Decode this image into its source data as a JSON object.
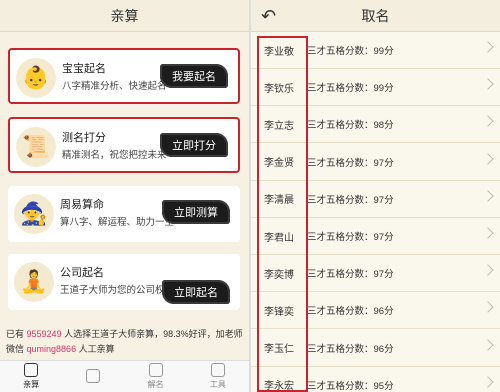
{
  "left": {
    "title": "亲算",
    "cards": [
      {
        "title": "宝宝起名",
        "desc": "八字精准分析、快速起名",
        "cta": "我要起名",
        "icon": "baby-icon"
      },
      {
        "title": "测名打分",
        "desc": "精准测名，祝您把控未来",
        "cta": "立即打分",
        "icon": "scholar-icon"
      },
      {
        "title": "周易算命",
        "desc": "算八字、解运程、助力一生",
        "cta": "立即测算",
        "icon": "sage-icon"
      },
      {
        "title": "公司起名",
        "desc": "王道子大师为您的公司权威起名",
        "cta": "立即起名",
        "icon": "master-icon"
      }
    ],
    "footer": {
      "line1_prefix": "已有",
      "count": "9559249",
      "line1_suffix": "人选择王道子大师亲算，98.3%好评，加老师",
      "line2_prefix": "微信",
      "wechat": "quming8866",
      "line2_suffix": "人工亲算"
    },
    "tabs": [
      {
        "label": "亲算",
        "active": true
      },
      {
        "label": "",
        "active": false
      },
      {
        "label": "解名",
        "active": false
      },
      {
        "label": "工具",
        "active": false
      }
    ]
  },
  "right": {
    "title": "取名",
    "back_icon": "back-arrow-icon",
    "rows": [
      {
        "name": "李业敬",
        "score": "三才五格分数：99分"
      },
      {
        "name": "李钦乐",
        "score": "三才五格分数：99分"
      },
      {
        "name": "李立志",
        "score": "三才五格分数：98分"
      },
      {
        "name": "李金贤",
        "score": "三才五格分数：97分"
      },
      {
        "name": "李清晨",
        "score": "三才五格分数：97分"
      },
      {
        "name": "李君山",
        "score": "三才五格分数：97分"
      },
      {
        "name": "李奕博",
        "score": "三才五格分数：97分"
      },
      {
        "name": "李锋奕",
        "score": "三才五格分数：96分"
      },
      {
        "name": "李玉仁",
        "score": "三才五格分数：96分"
      },
      {
        "name": "李永宏",
        "score": "三才五格分数：95分"
      }
    ]
  }
}
